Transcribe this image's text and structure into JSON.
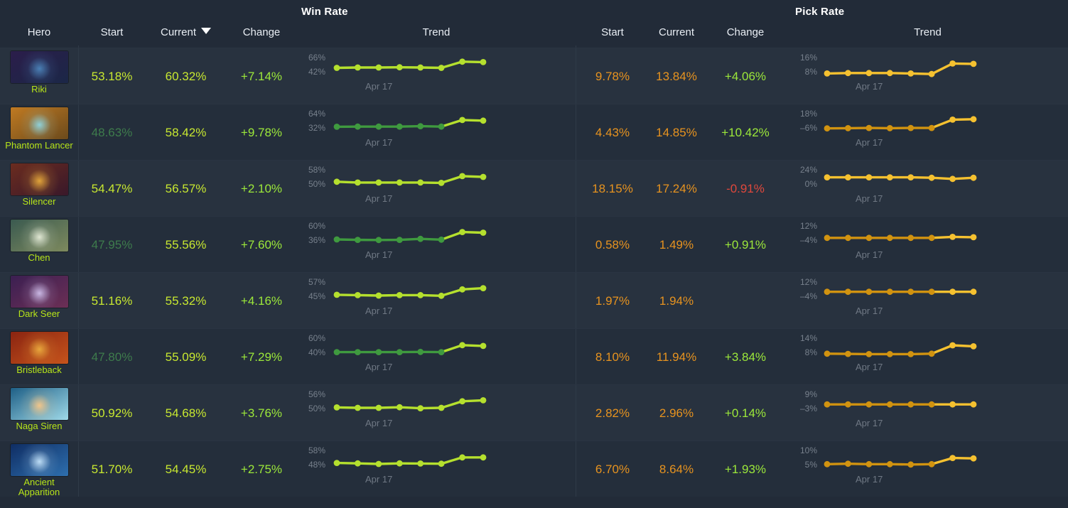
{
  "header": {
    "groups": [
      {
        "id": "win",
        "label": "Win Rate"
      },
      {
        "id": "pick",
        "label": "Pick Rate"
      }
    ],
    "columns": {
      "hero": "Hero",
      "win_start": "Start",
      "win_current": "Current",
      "win_change": "Change",
      "win_trend": "Trend",
      "pick_start": "Start",
      "pick_current": "Current",
      "pick_change": "Change",
      "pick_trend": "Trend"
    },
    "sorted_column": "win_current",
    "sort_direction": "descending",
    "sort_icon": "chevron-down-icon"
  },
  "colors": {
    "bright_green": "#c8e830",
    "dim_green": "#3e7c4c",
    "positive_green": "#9ce83a",
    "negative_red": "#e0483c",
    "orange": "#e7931f",
    "spark_green_bright": "#b5e02e",
    "spark_green_dim": "#3f9a3f",
    "spark_orange_bright": "#f5c130",
    "spark_orange_dim": "#d19310",
    "row_odd": "#28323f",
    "row_even": "#242e3b",
    "background": "#222b38"
  },
  "chart_data": {
    "type": "line",
    "note": "Eight sparkline pairs (Win Rate %, Pick Rate %) over 8 time points; x tick label 'Apr 17'",
    "x_tick_label": "Apr 17",
    "points_per_series": 8,
    "series": [
      {
        "hero": "Riki",
        "metric": "win",
        "ylim": [
          42,
          66
        ],
        "values": [
          53.2,
          53.4,
          53.4,
          53.5,
          53.4,
          53.2,
          60.9,
          60.3
        ]
      },
      {
        "hero": "Riki",
        "metric": "pick",
        "ylim": [
          8,
          16
        ],
        "values": [
          9.8,
          9.9,
          9.9,
          9.9,
          9.8,
          9.7,
          13.9,
          13.8
        ]
      },
      {
        "hero": "Phantom Lancer",
        "metric": "win",
        "ylim": [
          32,
          64
        ],
        "values": [
          48.6,
          48.8,
          48.8,
          48.8,
          49.2,
          48.9,
          58.9,
          58.4
        ]
      },
      {
        "hero": "Phantom Lancer",
        "metric": "pick",
        "ylim": [
          -6,
          18
        ],
        "values": [
          4.4,
          4.5,
          4.6,
          4.5,
          4.6,
          4.6,
          14.9,
          14.9
        ]
      },
      {
        "hero": "Silencer",
        "metric": "win",
        "ylim": [
          50,
          58
        ],
        "values": [
          54.5,
          54.3,
          54.3,
          54.3,
          54.3,
          54.2,
          56.9,
          56.6
        ]
      },
      {
        "hero": "Silencer",
        "metric": "pick",
        "ylim": [
          0,
          24
        ],
        "values": [
          18.2,
          18.2,
          18.2,
          18.2,
          18.2,
          18.0,
          17.2,
          17.2
        ]
      },
      {
        "hero": "Chen",
        "metric": "win",
        "ylim": [
          36,
          60
        ],
        "values": [
          48.0,
          48.1,
          48.0,
          48.1,
          48.5,
          48.2,
          55.9,
          55.6
        ]
      },
      {
        "hero": "Chen",
        "metric": "pick",
        "ylim": [
          -4,
          12
        ],
        "values": [
          0.6,
          0.6,
          0.6,
          0.6,
          0.6,
          0.6,
          1.5,
          1.5
        ]
      },
      {
        "hero": "Dark Seer",
        "metric": "win",
        "ylim": [
          45,
          57
        ],
        "values": [
          51.2,
          51.1,
          51.0,
          51.1,
          51.1,
          50.9,
          54.8,
          55.3
        ]
      },
      {
        "hero": "Dark Seer",
        "metric": "pick",
        "ylim": [
          -4,
          12
        ],
        "values": [
          2.0,
          2.0,
          2.0,
          2.0,
          2.0,
          2.0,
          1.9,
          1.9
        ]
      },
      {
        "hero": "Bristleback",
        "metric": "win",
        "ylim": [
          40,
          60
        ],
        "values": [
          47.8,
          47.9,
          47.8,
          47.9,
          48.0,
          47.8,
          55.4,
          55.1
        ]
      },
      {
        "hero": "Bristleback",
        "metric": "pick",
        "ylim": [
          8,
          14
        ],
        "values": [
          8.1,
          8.1,
          8.0,
          8.0,
          8.0,
          8.1,
          12.1,
          11.9
        ]
      },
      {
        "hero": "Naga Siren",
        "metric": "win",
        "ylim": [
          50,
          56
        ],
        "values": [
          50.9,
          50.9,
          50.9,
          51.0,
          50.8,
          50.9,
          54.6,
          54.7
        ]
      },
      {
        "hero": "Naga Siren",
        "metric": "pick",
        "ylim": [
          -3,
          9
        ],
        "values": [
          2.8,
          2.8,
          2.8,
          2.8,
          2.8,
          2.8,
          2.9,
          2.9
        ]
      },
      {
        "hero": "Ancient Apparition",
        "metric": "win",
        "ylim": [
          48,
          58
        ],
        "values": [
          51.7,
          51.6,
          51.5,
          51.7,
          51.6,
          51.5,
          54.7,
          54.5
        ]
      },
      {
        "hero": "Ancient Apparition",
        "metric": "pick",
        "ylim": [
          5,
          10
        ],
        "values": [
          6.7,
          6.7,
          6.7,
          6.7,
          6.6,
          6.7,
          8.7,
          8.6
        ]
      }
    ]
  },
  "rows": [
    {
      "hero": "Riki",
      "win": {
        "start": "53.18%",
        "current": "60.32%",
        "change": "+7.14%",
        "start_dim": false,
        "axis_hi": "66%",
        "axis_lo": "42%",
        "xlabel": "Apr 17",
        "y": [
          0.34,
          0.32,
          0.32,
          0.31,
          0.32,
          0.34,
          0.03,
          0.05
        ],
        "split": 6,
        "dim": false
      },
      "pick": {
        "start": "9.78%",
        "current": "13.84%",
        "change": "+4.06%",
        "axis_hi": "16%",
        "axis_lo": "8%",
        "xlabel": "Apr 17",
        "y": [
          0.62,
          0.6,
          0.6,
          0.6,
          0.62,
          0.65,
          0.12,
          0.14
        ],
        "split": 6,
        "dim": false
      }
    },
    {
      "hero": "Phantom Lancer",
      "win": {
        "start": "48.63%",
        "current": "58.42%",
        "change": "+9.78%",
        "start_dim": true,
        "axis_hi": "64%",
        "axis_lo": "32%",
        "xlabel": "Apr 17",
        "y": [
          0.48,
          0.47,
          0.47,
          0.47,
          0.45,
          0.47,
          0.14,
          0.17
        ],
        "split": 6,
        "dim": true
      },
      "pick": {
        "start": "4.43%",
        "current": "14.85%",
        "change": "+10.42%",
        "axis_hi": "18%",
        "axis_lo": "–6%",
        "xlabel": "Apr 17",
        "y": [
          0.56,
          0.55,
          0.54,
          0.55,
          0.54,
          0.54,
          0.12,
          0.1
        ],
        "split": 6,
        "dim": true
      }
    },
    {
      "hero": "Silencer",
      "win": {
        "start": "54.47%",
        "current": "56.57%",
        "change": "+2.10%",
        "start_dim": false,
        "axis_hi": "58%",
        "axis_lo": "50%",
        "xlabel": "Apr 17",
        "y": [
          0.42,
          0.46,
          0.46,
          0.46,
          0.46,
          0.48,
          0.14,
          0.18
        ],
        "split": 6,
        "dim": false
      },
      "pick": {
        "start": "18.15%",
        "current": "17.24%",
        "change": "-0.91%",
        "axis_hi": "24%",
        "axis_lo": "0%",
        "xlabel": "Apr 17",
        "y": [
          0.2,
          0.2,
          0.2,
          0.2,
          0.2,
          0.22,
          0.28,
          0.22
        ],
        "split": 6,
        "dim": false
      }
    },
    {
      "hero": "Chen",
      "win": {
        "start": "47.95%",
        "current": "55.56%",
        "change": "+7.60%",
        "start_dim": true,
        "axis_hi": "60%",
        "axis_lo": "36%",
        "xlabel": "Apr 17",
        "y": [
          0.5,
          0.52,
          0.53,
          0.52,
          0.47,
          0.51,
          0.13,
          0.16
        ],
        "split": 6,
        "dim": true
      },
      "pick": {
        "start": "0.58%",
        "current": "1.49%",
        "change": "+0.91%",
        "axis_hi": "12%",
        "axis_lo": "–4%",
        "xlabel": "Apr 17",
        "y": [
          0.42,
          0.42,
          0.42,
          0.42,
          0.42,
          0.42,
          0.37,
          0.39
        ],
        "split": 6,
        "dim": true
      }
    },
    {
      "hero": "Dark Seer",
      "win": {
        "start": "51.16%",
        "current": "55.32%",
        "change": "+4.16%",
        "start_dim": false,
        "axis_hi": "57%",
        "axis_lo": "45%",
        "xlabel": "Apr 17",
        "y": [
          0.46,
          0.48,
          0.5,
          0.48,
          0.48,
          0.51,
          0.19,
          0.13
        ],
        "split": 6,
        "dim": false
      },
      "pick": {
        "start": "1.97%",
        "current": "1.94%",
        "change": "",
        "axis_hi": "12%",
        "axis_lo": "–4%",
        "xlabel": "Apr 17",
        "y": [
          0.31,
          0.31,
          0.31,
          0.31,
          0.31,
          0.31,
          0.31,
          0.31
        ],
        "split": 6,
        "dim": true
      }
    },
    {
      "hero": "Bristleback",
      "win": {
        "start": "47.80%",
        "current": "55.09%",
        "change": "+7.29%",
        "start_dim": true,
        "axis_hi": "60%",
        "axis_lo": "40%",
        "xlabel": "Apr 17",
        "y": [
          0.52,
          0.52,
          0.52,
          0.52,
          0.51,
          0.52,
          0.17,
          0.21
        ],
        "split": 6,
        "dim": true
      },
      "pick": {
        "start": "8.10%",
        "current": "11.94%",
        "change": "+3.84%",
        "axis_hi": "14%",
        "axis_lo": "8%",
        "xlabel": "Apr 17",
        "y": [
          0.6,
          0.61,
          0.62,
          0.62,
          0.62,
          0.6,
          0.18,
          0.23
        ],
        "split": 6,
        "dim": true
      }
    },
    {
      "hero": "Naga Siren",
      "win": {
        "start": "50.92%",
        "current": "54.68%",
        "change": "+3.76%",
        "start_dim": false,
        "axis_hi": "56%",
        "axis_lo": "50%",
        "xlabel": "Apr 17",
        "y": [
          0.48,
          0.5,
          0.5,
          0.47,
          0.52,
          0.5,
          0.17,
          0.12
        ],
        "split": 6,
        "dim": false
      },
      "pick": {
        "start": "2.82%",
        "current": "2.96%",
        "change": "+0.14%",
        "axis_hi": "9%",
        "axis_lo": "–3%",
        "xlabel": "Apr 17",
        "y": [
          0.33,
          0.33,
          0.33,
          0.33,
          0.33,
          0.33,
          0.33,
          0.33
        ],
        "split": 6,
        "dim": true
      }
    },
    {
      "hero": "Ancient Apparition",
      "win": {
        "start": "51.70%",
        "current": "54.45%",
        "change": "+2.75%",
        "start_dim": false,
        "axis_hi": "58%",
        "axis_lo": "48%",
        "xlabel": "Apr 17",
        "y": [
          0.45,
          0.47,
          0.5,
          0.47,
          0.48,
          0.49,
          0.17,
          0.17
        ],
        "split": 6,
        "dim": false
      },
      "pick": {
        "start": "6.70%",
        "current": "8.64%",
        "change": "+1.93%",
        "axis_hi": "10%",
        "axis_lo": "5%",
        "xlabel": "Apr 17",
        "y": [
          0.51,
          0.49,
          0.51,
          0.51,
          0.53,
          0.51,
          0.2,
          0.22
        ],
        "split": 6,
        "dim": true
      }
    }
  ]
}
